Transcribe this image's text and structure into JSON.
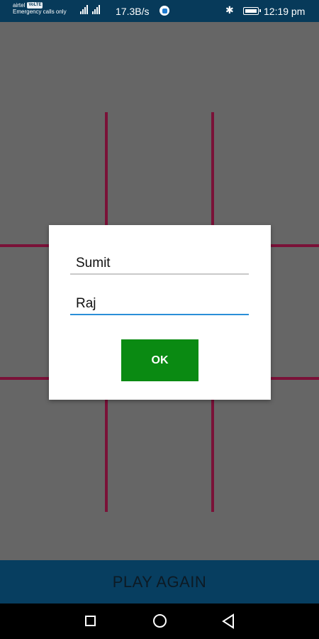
{
  "status_bar": {
    "carrier": "airtel",
    "carrier_badge": "VoLTE",
    "emergency_text": "Emergency calls only",
    "net_speed": "17.3B/s",
    "time": "12:19 pm",
    "icons": [
      "signal-icon",
      "signal-icon",
      "shield-icon",
      "bluetooth-icon",
      "battery-icon"
    ]
  },
  "board": {
    "line_color": "#7a1138",
    "background_color": "#666666"
  },
  "dialog": {
    "player1_value": "Sumit",
    "player2_value": "Raj",
    "ok_label": "OK",
    "ok_color": "#0a8a12",
    "active_underline_color": "#2a8fd8"
  },
  "footer": {
    "play_again_label": "PLAY AGAIN",
    "background_color": "#073e60"
  },
  "nav_bar": {
    "buttons": [
      "recent-apps-icon",
      "home-icon",
      "back-icon"
    ]
  }
}
